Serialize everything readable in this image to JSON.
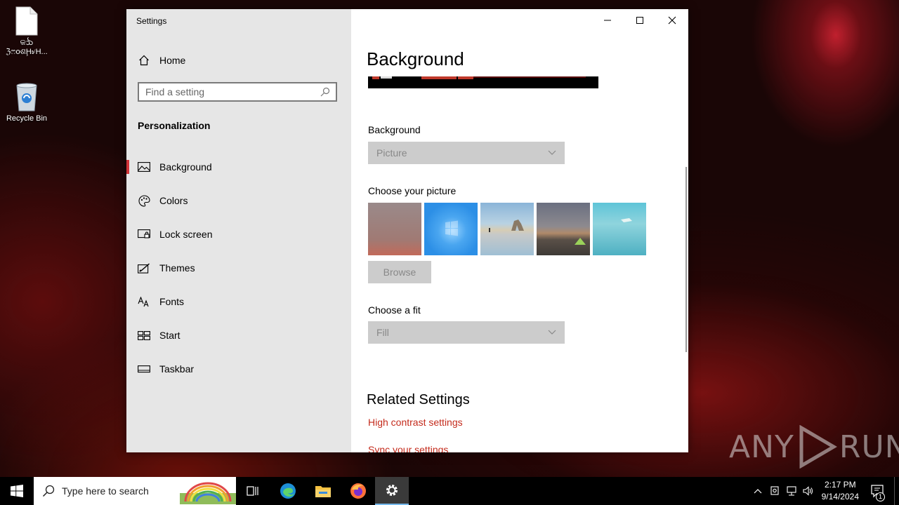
{
  "desktop": {
    "icons": [
      {
        "label_line1": "କᨨ",
        "label_line2": "ℨෆᴏଶḨ৶H..."
      },
      {
        "label_line1": "Recycle Bin",
        "label_line2": ""
      }
    ]
  },
  "window": {
    "title": "Settings",
    "controls": {
      "minimize": "minimize",
      "maximize": "maximize",
      "close": "close"
    }
  },
  "sidebar": {
    "home_label": "Home",
    "search_placeholder": "Find a setting",
    "section_title": "Personalization",
    "items": [
      {
        "label": "Background",
        "icon": "picture-icon",
        "active": true
      },
      {
        "label": "Colors",
        "icon": "palette-icon",
        "active": false
      },
      {
        "label": "Lock screen",
        "icon": "lock-screen-icon",
        "active": false
      },
      {
        "label": "Themes",
        "icon": "themes-icon",
        "active": false
      },
      {
        "label": "Fonts",
        "icon": "fonts-icon",
        "active": false
      },
      {
        "label": "Start",
        "icon": "start-icon",
        "active": false
      },
      {
        "label": "Taskbar",
        "icon": "taskbar-icon",
        "active": false
      }
    ]
  },
  "main": {
    "page_title": "Background",
    "background_label": "Background",
    "background_value": "Picture",
    "choose_picture_label": "Choose your picture",
    "browse_label": "Browse",
    "choose_fit_label": "Choose a fit",
    "fit_value": "Fill",
    "related_title": "Related Settings",
    "links": [
      "High contrast settings",
      "Sync your settings"
    ]
  },
  "taskbar": {
    "search_placeholder": "Type here to search",
    "time": "2:17 PM",
    "date": "9/14/2024",
    "notification_count": "1"
  },
  "watermark": {
    "text_left": "ANY",
    "text_right": "RUN"
  },
  "colors": {
    "accent": "#d13438",
    "link": "#c42b1c"
  }
}
